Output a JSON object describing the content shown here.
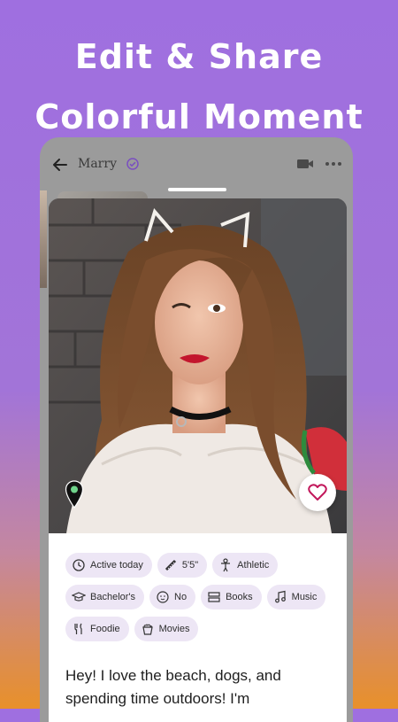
{
  "promo": {
    "line1": "Edit & Share",
    "line2": "Colorful Moment"
  },
  "header": {
    "name": "Marry"
  },
  "tags": {
    "active": "Active today",
    "height": "5'5\"",
    "body": "Athletic",
    "education": "Bachelor's",
    "kids": "No",
    "books": "Books",
    "music": "Music",
    "foodie": "Foodie",
    "movies": "Movies"
  },
  "bio": "Hey! I love the beach, dogs, and spending time outdoors! I'm",
  "colors": {
    "accent": "#7a4fc0",
    "tag_bg": "#ede6f5",
    "like": "#c2185b"
  }
}
